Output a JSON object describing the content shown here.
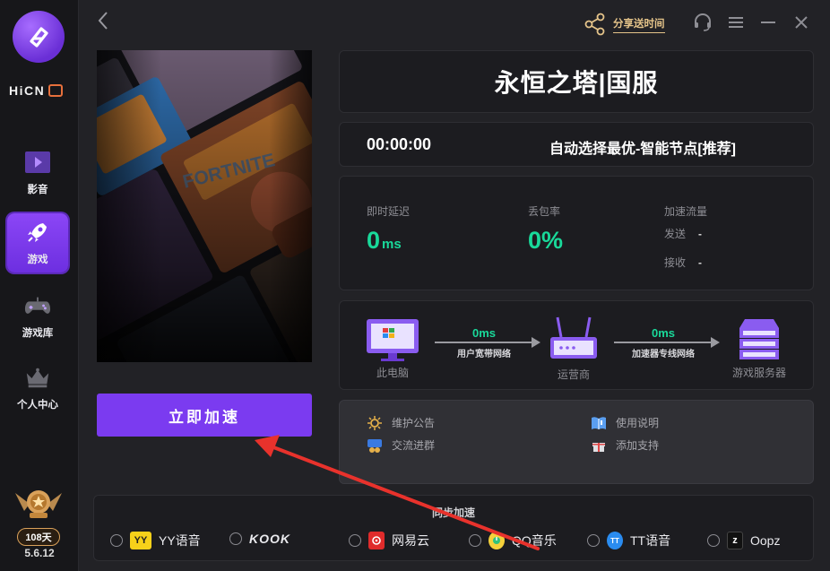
{
  "sidebar": {
    "brand": "HiCN",
    "items": [
      {
        "label": "影音",
        "icon": "video-play-icon"
      },
      {
        "label": "游戏",
        "icon": "rocket-icon",
        "active": true
      },
      {
        "label": "游戏库",
        "icon": "gamepad-icon"
      },
      {
        "label": "个人中心",
        "icon": "crown-icon"
      }
    ],
    "days": "108天",
    "version": "5.6.12"
  },
  "topbar": {
    "share_label": "分享送时间"
  },
  "game": {
    "title": "永恒之塔|国服",
    "timer": "00:00:00",
    "node": "自动选择最优-智能节点[推荐]",
    "accelerate_button": "立即加速"
  },
  "stats": {
    "latency_label": "即时延迟",
    "latency_value": "0",
    "latency_unit": "ms",
    "loss_label": "丢包率",
    "loss_value": "0%",
    "traffic_label": "加速流量",
    "send_label": "发送",
    "send_value": "-",
    "recv_label": "接收",
    "recv_value": "-"
  },
  "network": {
    "pc_label": "此电脑",
    "isp_label": "运营商",
    "server_label": "游戏服务器",
    "link1_ms": "0ms",
    "link1_desc": "用户宽带网络",
    "link2_ms": "0ms",
    "link2_desc": "加速器专线网络"
  },
  "notices": {
    "maintenance": "维护公告",
    "group": "交流进群",
    "manual": "使用说明",
    "support": "添加支持"
  },
  "sync": {
    "title": "同步加速",
    "apps": [
      {
        "name": "YY语音",
        "logo": "yy-logo-icon",
        "color": "#f7d11a"
      },
      {
        "name": "KOOK",
        "logo": "kook-logo-icon",
        "color": "#ffffff"
      },
      {
        "name": "网易云",
        "logo": "netease-music-icon",
        "color": "#e02b2b"
      },
      {
        "name": "QQ音乐",
        "logo": "qq-music-icon",
        "color": "#31c27c"
      },
      {
        "name": "TT语音",
        "logo": "tt-voice-icon",
        "color": "#2a8cf0"
      },
      {
        "name": "Oopz",
        "logo": "oopz-logo-icon",
        "color": "#ffffff"
      }
    ]
  }
}
